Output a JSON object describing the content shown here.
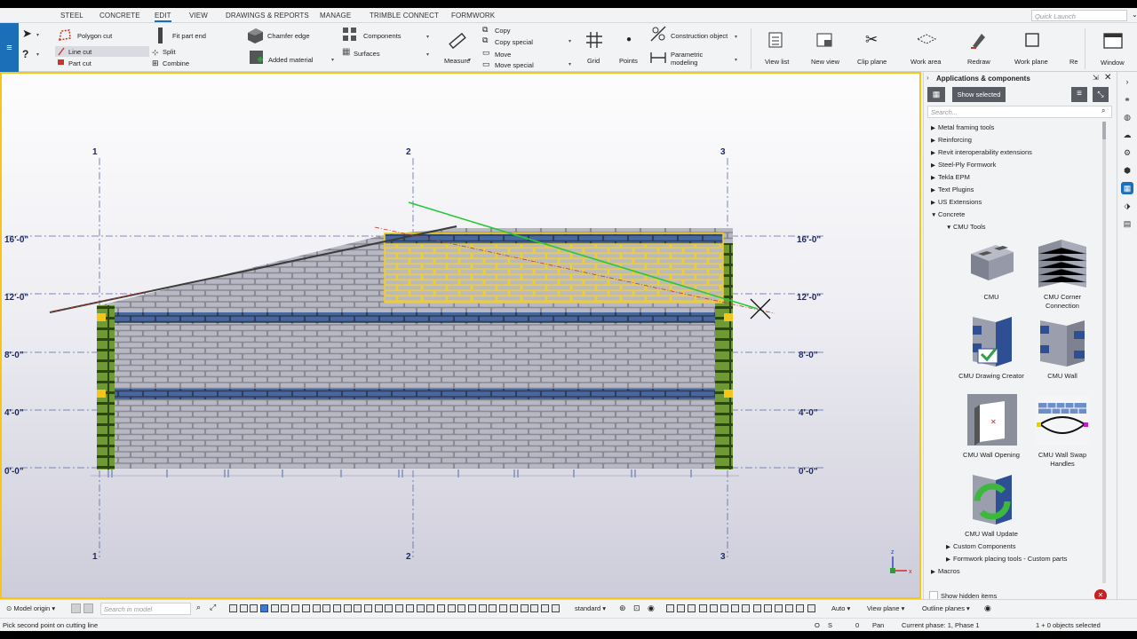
{
  "menu": {
    "tabs": [
      "STEEL",
      "CONCRETE",
      "EDIT",
      "VIEW",
      "DRAWINGS & REPORTS",
      "MANAGE",
      "TRIMBLE CONNECT",
      "FORMWORK"
    ],
    "active": "EDIT",
    "quick_launch_placeholder": "Quick Launch"
  },
  "ribbon": {
    "polygon_cut": "Polygon cut",
    "line_cut": "Line cut",
    "part_cut": "Part cut",
    "fit_part_end": "Fit part end",
    "split": "Split",
    "combine": "Combine",
    "chamfer_edge": "Chamfer edge",
    "added_material": "Added material",
    "components": "Components",
    "surfaces": "Surfaces",
    "measure": "Measure",
    "copy": "Copy",
    "copy_special": "Copy special",
    "move": "Move",
    "move_special": "Move special",
    "grid": "Grid",
    "points": "Points",
    "construction_object": "Construction object",
    "parametric_modeling_1": "Parametric",
    "parametric_modeling_2": "modeling",
    "view_list": "View list",
    "new_view": "New view",
    "clip_plane": "Clip plane",
    "work_area": "Work area",
    "redraw": "Redraw",
    "work_plane": "Work plane",
    "re": "Re",
    "window": "Window"
  },
  "viewport": {
    "grid_labels_x": [
      "1",
      "2",
      "3"
    ],
    "elevations": [
      "16'-0\"",
      "12'-0\"",
      "8'-0\"",
      "4'-0\"",
      "0'-0\""
    ],
    "axis_z": "z",
    "axis_x": "x"
  },
  "panel": {
    "title": "Applications & components",
    "show_selected": "Show selected",
    "search_placeholder": "Search...",
    "tree": [
      "Metal framing tools",
      "Reinforcing",
      "Revit interoperability extensions",
      "Steel-Ply Formwork",
      "Tekla EPM",
      "Text Plugins",
      "US Extensions"
    ],
    "open_group": "Concrete",
    "sub_group": "CMU Tools",
    "components": [
      "CMU",
      "CMU Corner Connection",
      "CMU Drawing Creator",
      "CMU Wall",
      "CMU Wall Opening",
      "CMU Wall Swap Handles",
      "CMU Wall Update"
    ],
    "after": [
      "Custom Components",
      "Formwork placing tools - Custom parts"
    ],
    "macros": "Macros",
    "show_hidden": "Show hidden items"
  },
  "bottom": {
    "model_origin": "Model origin",
    "search_placeholder": "Search in model",
    "standard": "standard",
    "auto": "Auto",
    "view_plane": "View plane",
    "outline_planes": "Outline planes"
  },
  "status": {
    "prompt": "Pick second point on cutting line",
    "o": "O",
    "s": "S",
    "zero": "0",
    "pan": "Pan",
    "phase": "Current phase: 1, Phase 1",
    "selected": "1 + 0 objects selected"
  }
}
